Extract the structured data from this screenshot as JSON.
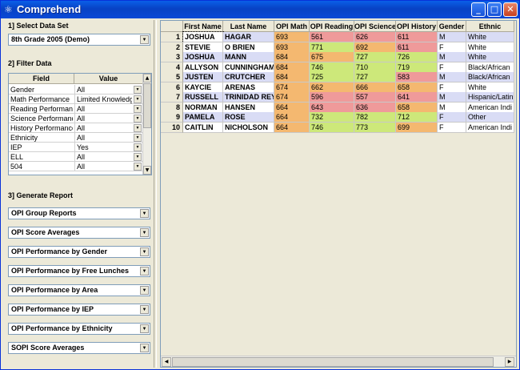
{
  "window": {
    "title": "Comprehend",
    "minimize": "_",
    "maximize": "□",
    "close": "✕"
  },
  "left": {
    "select_label": "1] Select Data Set",
    "dataset": "8th Grade 2005 (Demo)",
    "filter_label": "2] Filter Data",
    "filter_headers": {
      "field": "Field",
      "value": "Value"
    },
    "filters": [
      {
        "field": "Gender",
        "value": "All"
      },
      {
        "field": "Math Performance",
        "value": "Limited Knowledge"
      },
      {
        "field": "Reading Performance",
        "value": "All"
      },
      {
        "field": "Science Performance",
        "value": "All"
      },
      {
        "field": "History Performance",
        "value": "All"
      },
      {
        "field": "Ethnicity",
        "value": "All"
      },
      {
        "field": "IEP",
        "value": "Yes"
      },
      {
        "field": "ELL",
        "value": "All"
      },
      {
        "field": "504",
        "value": "All"
      }
    ],
    "report_label": "3] Generate Report",
    "reports": [
      "OPI Group Reports",
      "OPI Score Averages",
      "OPI Performance by Gender",
      "OPI Performance by Free Lunches",
      "OPI Performance by Area",
      "OPI Performance by IEP",
      "OPI Performance by Ethnicity",
      "SOPI Score Averages"
    ]
  },
  "grid": {
    "columns": [
      "First Name",
      "Last Name",
      "OPI Math",
      "OPI Reading",
      "OPI Science",
      "OPI History",
      "Gender",
      "Ethnic"
    ],
    "rows": [
      {
        "n": "1",
        "first": "JOSHUA",
        "last": "HAGAR",
        "math": "693",
        "reading": "561",
        "science": "626",
        "history": "611",
        "gender": "M",
        "ethnic": "White"
      },
      {
        "n": "2",
        "first": "STEVIE",
        "last": "O BRIEN",
        "math": "693",
        "reading": "771",
        "science": "692",
        "history": "611",
        "gender": "F",
        "ethnic": "White"
      },
      {
        "n": "3",
        "first": "JOSHUA",
        "last": "MANN",
        "math": "684",
        "reading": "675",
        "science": "727",
        "history": "726",
        "gender": "M",
        "ethnic": "White"
      },
      {
        "n": "4",
        "first": "ALLYSON",
        "last": "CUNNINGHAM",
        "math": "684",
        "reading": "746",
        "science": "710",
        "history": "719",
        "gender": "F",
        "ethnic": "Black/African"
      },
      {
        "n": "5",
        "first": "JUSTEN",
        "last": "CRUTCHER",
        "math": "684",
        "reading": "725",
        "science": "727",
        "history": "583",
        "gender": "M",
        "ethnic": "Black/African"
      },
      {
        "n": "6",
        "first": "KAYCIE",
        "last": "ARENAS",
        "math": "674",
        "reading": "662",
        "science": "666",
        "history": "658",
        "gender": "F",
        "ethnic": "White"
      },
      {
        "n": "7",
        "first": "RUSSELL",
        "last": "TRINIDAD REYES",
        "math": "674",
        "reading": "596",
        "science": "557",
        "history": "641",
        "gender": "M",
        "ethnic": "Hispanic/Latin"
      },
      {
        "n": "8",
        "first": "NORMAN",
        "last": "HANSEN",
        "math": "664",
        "reading": "643",
        "science": "636",
        "history": "658",
        "gender": "M",
        "ethnic": "American Indi"
      },
      {
        "n": "9",
        "first": "PAMELA",
        "last": "ROSE",
        "math": "664",
        "reading": "732",
        "science": "782",
        "history": "712",
        "gender": "F",
        "ethnic": "Other"
      },
      {
        "n": "10",
        "first": "CAITLIN",
        "last": "NICHOLSON",
        "math": "664",
        "reading": "746",
        "science": "773",
        "history": "699",
        "gender": "F",
        "ethnic": "American Indi"
      }
    ],
    "colors": {
      "orange": "#f4b870",
      "red": "#ef9a9a",
      "green": "#cde87a",
      "white": "#ffffff",
      "lavender": "#d9dcf5",
      "row_even": "#eef6e0"
    }
  }
}
